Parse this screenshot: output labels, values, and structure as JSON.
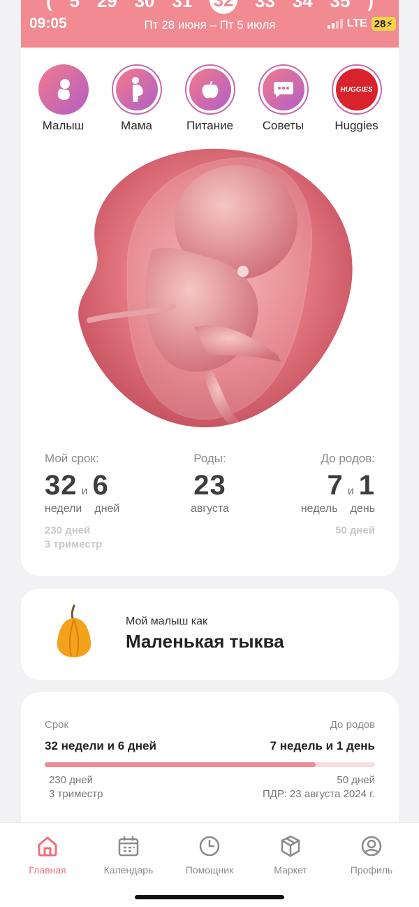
{
  "status_bar": {
    "time": "09:05",
    "network": "LTE",
    "battery": "28"
  },
  "header": {
    "date_range": "Пт 28 июня – Пт 5 июля",
    "week_days": [
      "(",
      "5",
      "29",
      "30",
      "31",
      "32",
      "33",
      "34",
      "35",
      ")"
    ],
    "selected_day": "32",
    "background": "#f28a92"
  },
  "categories": [
    {
      "label": "Малыш",
      "icon": "baby-icon"
    },
    {
      "label": "Мама",
      "icon": "pregnant-icon"
    },
    {
      "label": "Питание",
      "icon": "apple-icon"
    },
    {
      "label": "Советы",
      "icon": "chat-bubble-icon"
    },
    {
      "label": "Huggies",
      "icon": "huggies-logo",
      "logo_text": "HUGGIES"
    }
  ],
  "term": {
    "my_term": {
      "label": "Мой срок:",
      "weeks": "32",
      "and": "и",
      "days": "6",
      "weeks_unit": "недели",
      "days_unit": "дней",
      "total_days": "230 дней",
      "trimester": "3 триместр"
    },
    "birth": {
      "label": "Роды:",
      "day": "23",
      "month": "августа"
    },
    "until_birth": {
      "label": "До родов:",
      "weeks": "7",
      "and": "и",
      "days": "1",
      "weeks_unit": "недель",
      "days_unit": "день",
      "total_days": "50 дней"
    }
  },
  "fruit": {
    "prefix": "Мой малыш как",
    "name": "Маленькая тыква"
  },
  "progress": {
    "left_label": "Срок",
    "right_label": "До родов",
    "left_value": "32 недели и 6 дней",
    "right_value": "7 недель и 1 день",
    "fraction": 0.82,
    "left_days": "230 дней",
    "left_trimester": "3 триместр",
    "right_days": "50 дней",
    "due_date": "ПДР: 23 августа 2024 г."
  },
  "tabbar": {
    "items": [
      {
        "label": "Главная",
        "icon": "home-icon",
        "active": true
      },
      {
        "label": "Календарь",
        "icon": "calendar-icon"
      },
      {
        "label": "Помощник",
        "icon": "clock-icon"
      },
      {
        "label": "Маркет",
        "icon": "box-icon"
      },
      {
        "label": "Профиль",
        "icon": "profile-icon"
      }
    ]
  },
  "colors": {
    "accent": "#f0707c",
    "brand_pink": "#f28a92",
    "huggies_red": "#d8222c"
  }
}
